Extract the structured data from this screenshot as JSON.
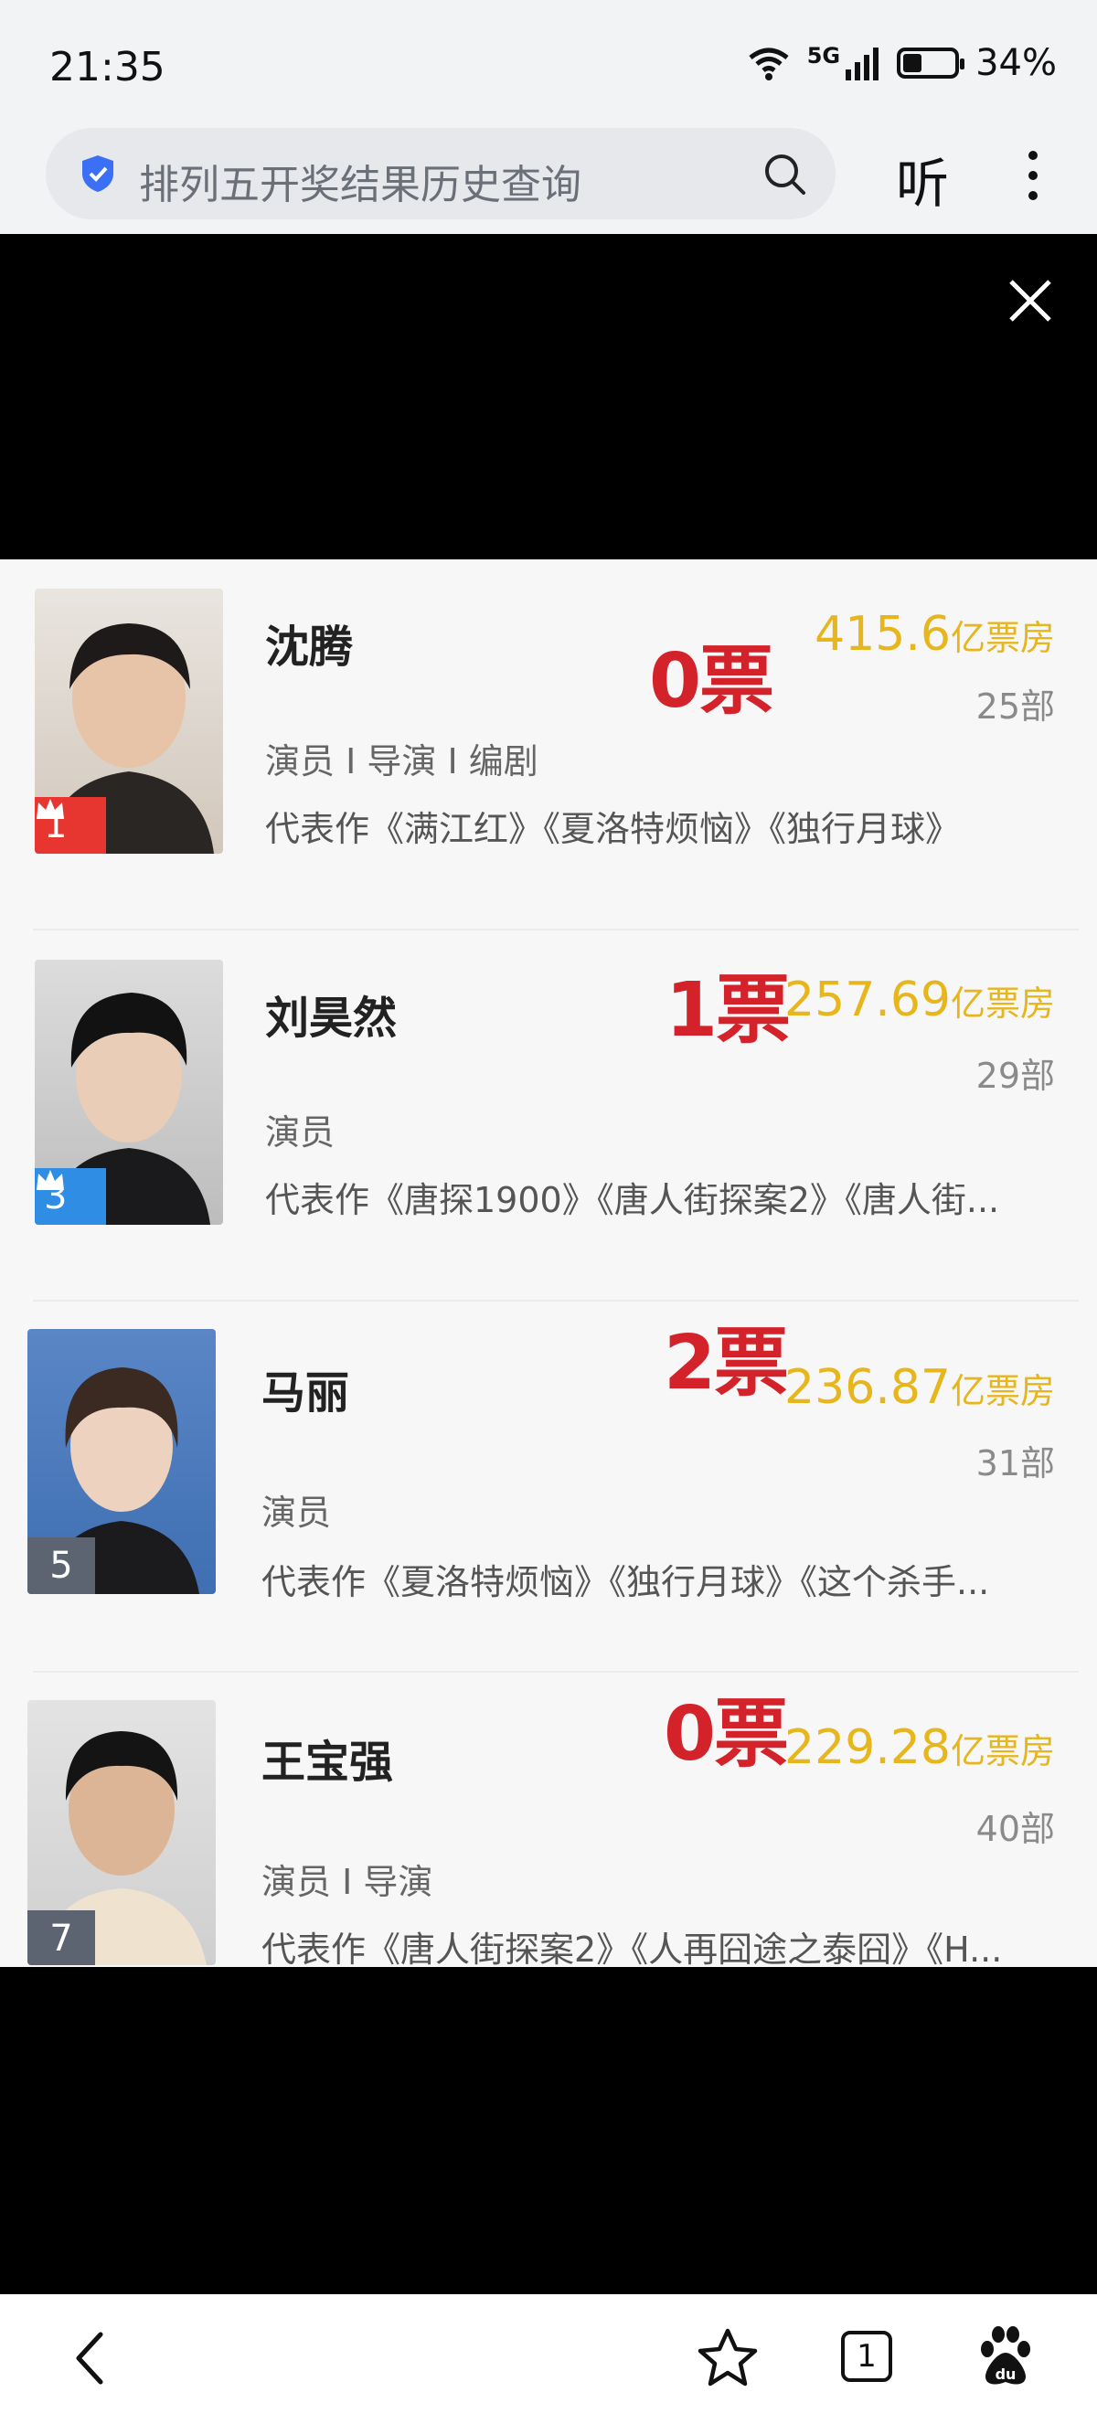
{
  "status": {
    "time": "21:35",
    "network": "5G",
    "battery": "34%",
    "battery_level": 0.34
  },
  "browser": {
    "query": "排列五开奖结果历史查询",
    "listen_label": "听"
  },
  "people": [
    {
      "name": "沈腾",
      "votes": "0票",
      "box_office": "415.6",
      "box_unit": "亿票房",
      "films": "25部",
      "roles": "演员 I 导演 I 编剧",
      "works": "代表作《满江红》《夏洛特烦恼》《独行月球》",
      "rank": "1"
    },
    {
      "name": "刘昊然",
      "votes": "1票",
      "box_office": "257.69",
      "box_unit": "亿票房",
      "films": "29部",
      "roles": "演员",
      "works": "代表作《唐探1900》《唐人街探案2》《唐人街...",
      "rank": "3"
    },
    {
      "name": "马丽",
      "votes": "2票",
      "box_office": "236.87",
      "box_unit": "亿票房",
      "films": "31部",
      "roles": "演员",
      "works": "代表作《夏洛特烦恼》《独行月球》《这个杀手...",
      "rank": "5"
    },
    {
      "name": "王宝强",
      "votes": "0票",
      "box_office": "229.28",
      "box_unit": "亿票房",
      "films": "40部",
      "roles": "演员 I 导演",
      "works": "代表作《唐人街探案2》《人再囧途之泰囧》《H...",
      "rank": "7"
    }
  ],
  "bottom_nav": {
    "tab_count": "1"
  },
  "colors": {
    "votes": "#d3222a",
    "box_office": "#e7b51c",
    "rank_gold": "#e6362f",
    "rank_blue": "#2f8de4",
    "rank_gray": "#5b6470"
  }
}
